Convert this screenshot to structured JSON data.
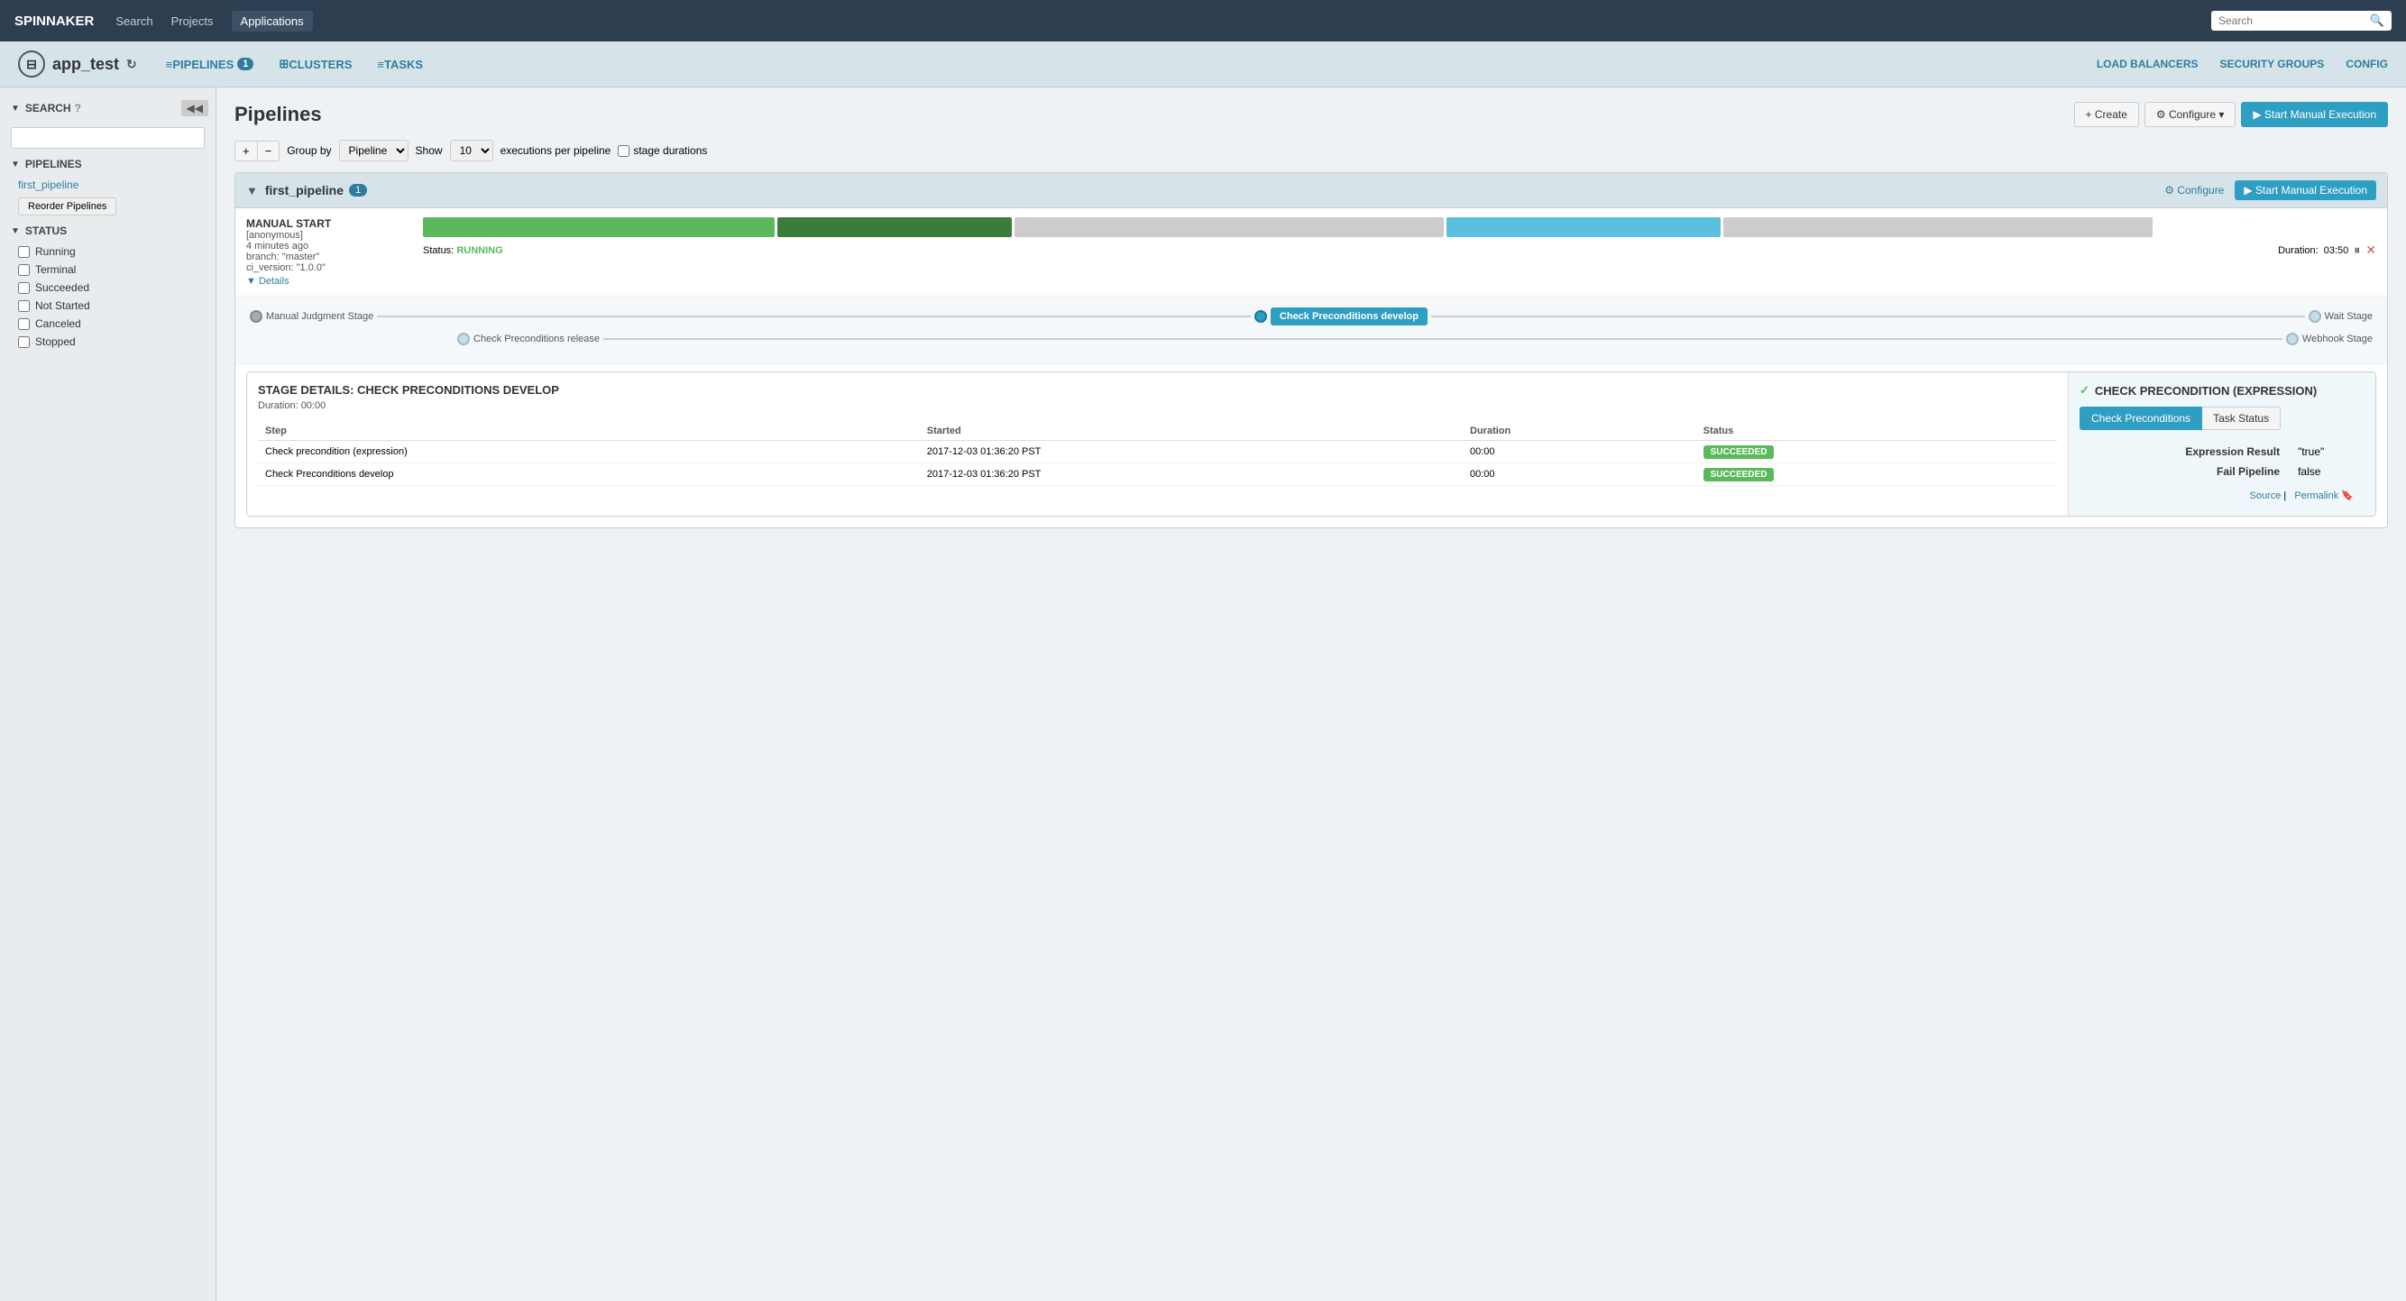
{
  "topnav": {
    "brand": "SPINNAKER",
    "links": [
      {
        "label": "Search",
        "active": false
      },
      {
        "label": "Projects",
        "active": false
      },
      {
        "label": "Applications",
        "active": true
      }
    ],
    "search_placeholder": "Search"
  },
  "appheader": {
    "app_name": "app_test",
    "nav": [
      {
        "label": "PIPELINES",
        "badge": "1",
        "icon": "≡"
      },
      {
        "label": "CLUSTERS",
        "icon": "⊞"
      },
      {
        "label": "TASKS",
        "icon": "≡"
      }
    ],
    "right_links": [
      "LOAD BALANCERS",
      "SECURITY GROUPS",
      "CONFIG"
    ]
  },
  "sidebar": {
    "collapse_btn": "◀◀",
    "search_section": "SEARCH",
    "search_placeholder": "",
    "pipelines_section": "PIPELINES",
    "pipeline_items": [
      "first_pipeline"
    ],
    "reorder_btn": "Reorder Pipelines",
    "status_section": "STATUS",
    "status_items": [
      "Running",
      "Terminal",
      "Succeeded",
      "Not Started",
      "Canceled",
      "Stopped"
    ]
  },
  "content": {
    "title": "Pipelines",
    "create_btn": "+ Create",
    "configure_btn": "⚙ Configure ▾",
    "start_btn": "▶ Start Manual Execution",
    "toolbar": {
      "plus": "+",
      "minus": "−",
      "groupby_label": "Group by",
      "groupby_value": "Pipeline",
      "show_label": "Show",
      "show_value": "10",
      "executions_label": "executions per pipeline",
      "stage_durations_label": "stage durations"
    },
    "pipeline": {
      "name": "first_pipeline",
      "badge": "1",
      "configure_link": "⚙ Configure",
      "start_link": "▶ Start Manual Execution",
      "execution": {
        "trigger": "MANUAL START",
        "user": "[anonymous]",
        "time": "4 minutes ago",
        "branch": "branch: \"master\"",
        "ci_version": "ci_version: \"1.0.0\"",
        "details_link": "▼ Details",
        "status_label": "Status:",
        "status_value": "RUNNING",
        "duration_label": "Duration:",
        "duration_value": "03:50",
        "progress_segments": [
          {
            "width": 18,
            "class": "seg-green"
          },
          {
            "width": 12,
            "class": "seg-dark-green"
          },
          {
            "width": 22,
            "class": "seg-gray"
          },
          {
            "width": 14,
            "class": "seg-cyan"
          },
          {
            "width": 22,
            "class": "seg-gray"
          }
        ]
      },
      "stages": [
        {
          "label": "Manual Judgment Stage",
          "type": "gray"
        },
        {
          "label": "Check Preconditions develop",
          "type": "active"
        },
        {
          "label": "Wait Stage",
          "type": "light"
        },
        {
          "label": "Check Preconditions release",
          "type": "light"
        },
        {
          "label": "Webhook Stage",
          "type": "light"
        }
      ]
    },
    "stage_details": {
      "title": "STAGE DETAILS: CHECK PRECONDITIONS DEVELOP",
      "duration": "Duration: 00:00",
      "columns": [
        "Step",
        "Started",
        "Duration",
        "Status"
      ],
      "rows": [
        {
          "step": "Check precondition (expression)",
          "started": "2017-12-03 01:36:20 PST",
          "duration": "00:00",
          "status": "SUCCEEDED"
        },
        {
          "step": "Check Preconditions develop",
          "started": "2017-12-03 01:36:20 PST",
          "duration": "00:00",
          "status": "SUCCEEDED"
        }
      ],
      "right_title": "CHECK PRECONDITION (EXPRESSION)",
      "right_check_icon": "✓",
      "tabs": [
        "Check Preconditions",
        "Task Status"
      ],
      "active_tab": "Check Preconditions",
      "result_rows": [
        {
          "label": "Expression Result",
          "value": "\"true\""
        },
        {
          "label": "Fail Pipeline",
          "value": "false"
        }
      ],
      "footer_links": [
        "Source",
        "Permalink"
      ],
      "footer_icon": "🔖"
    }
  }
}
